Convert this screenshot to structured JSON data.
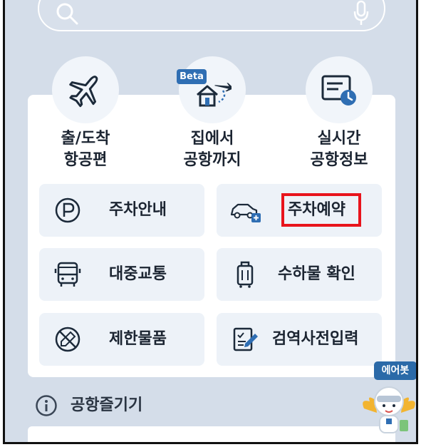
{
  "search": {
    "placeholder": ""
  },
  "quick_menu": [
    {
      "label_line1": "출/도착",
      "label_line2": "항공편",
      "icon": "airplane-icon"
    },
    {
      "label_line1": "집에서",
      "label_line2": "공항까지",
      "icon": "home-to-airport-icon",
      "badge": "Beta"
    },
    {
      "label_line1": "실시간",
      "label_line2": "공항정보",
      "icon": "realtime-info-icon"
    }
  ],
  "services": [
    {
      "label": "주차안내",
      "icon": "parking-icon"
    },
    {
      "label": "주차예약",
      "icon": "car-reservation-icon",
      "highlighted": true
    },
    {
      "label": "대중교통",
      "icon": "bus-icon"
    },
    {
      "label": "수하물 확인",
      "icon": "luggage-icon"
    },
    {
      "label": "제한물품",
      "icon": "prohibited-items-icon"
    },
    {
      "label": "검역사전입력",
      "icon": "quarantine-form-icon"
    }
  ],
  "enjoy": {
    "title": "공항즐기기",
    "icon": "info-icon"
  },
  "chatbot": {
    "badge": "에어봇",
    "icon": "airbot-mascot-icon"
  },
  "colors": {
    "background": "#d4dde9",
    "accent": "#2f6eb3",
    "highlight": "#e8141c",
    "text": "#1b2431"
  }
}
